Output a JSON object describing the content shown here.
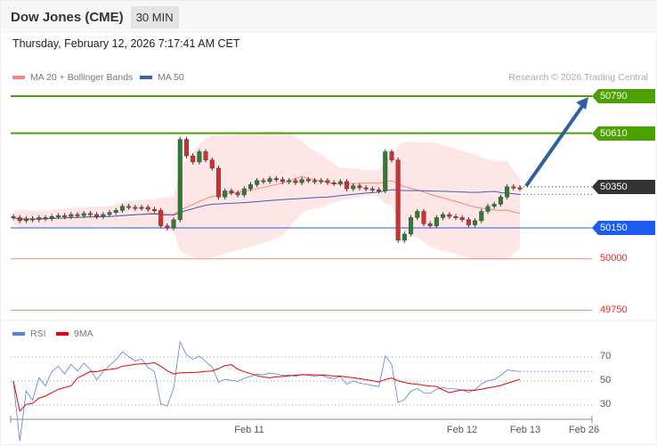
{
  "header": {
    "title": "Dow Jones (CME)",
    "timeframe": "30 MIN",
    "datetime": "Thursday, February 12, 2026 7:17:41 AM CET"
  },
  "legend": {
    "ma20": "MA 20 + Bollinger Bands",
    "ma50": "MA 50",
    "rsi": "RSI",
    "ma9": "9MA",
    "credit": "Research © 2026 Trading Central"
  },
  "colors": {
    "resistance": "#4ca000",
    "current": "#333333",
    "pivot": "#1a5cf0",
    "support": "#ff5050",
    "bull": "#2e7d32",
    "bear": "#d32f2f",
    "ma20": "#ff8080",
    "ma50": "#3a62b0",
    "rsi": "#5a7de0"
  },
  "levels": {
    "r2": "50790",
    "r1": "50610",
    "last": "50350",
    "pivot": "50150",
    "s1": "50000",
    "s2": "49750"
  },
  "xaxis": [
    "Feb 11",
    "Feb 12",
    "Feb 13",
    "Feb 26"
  ],
  "rsi_axis": [
    "70",
    "50",
    "30"
  ],
  "chart_data": {
    "type": "candlestick",
    "price_range": [
      49750,
      50790
    ],
    "target": 50790,
    "closes": [
      50200,
      50185,
      50195,
      50190,
      50200,
      50195,
      50205,
      50210,
      50205,
      50215,
      50210,
      50220,
      50215,
      50205,
      50215,
      50225,
      50235,
      50255,
      50250,
      50245,
      50250,
      50240,
      50235,
      50160,
      50150,
      50190,
      50580,
      50500,
      50470,
      50520,
      50480,
      50440,
      50300,
      50330,
      50320,
      50310,
      50340,
      50360,
      50380,
      50375,
      50390,
      50385,
      50375,
      50380,
      50370,
      50385,
      50380,
      50375,
      50380,
      50370,
      50365,
      50375,
      50340,
      50355,
      50345,
      50340,
      50335,
      50330,
      50520,
      50480,
      50090,
      50120,
      50200,
      50230,
      50170,
      50160,
      50200,
      50215,
      50205,
      50200,
      50190,
      50165,
      50185,
      50230,
      50255,
      50265,
      50300,
      50350,
      50345,
      50340
    ]
  }
}
